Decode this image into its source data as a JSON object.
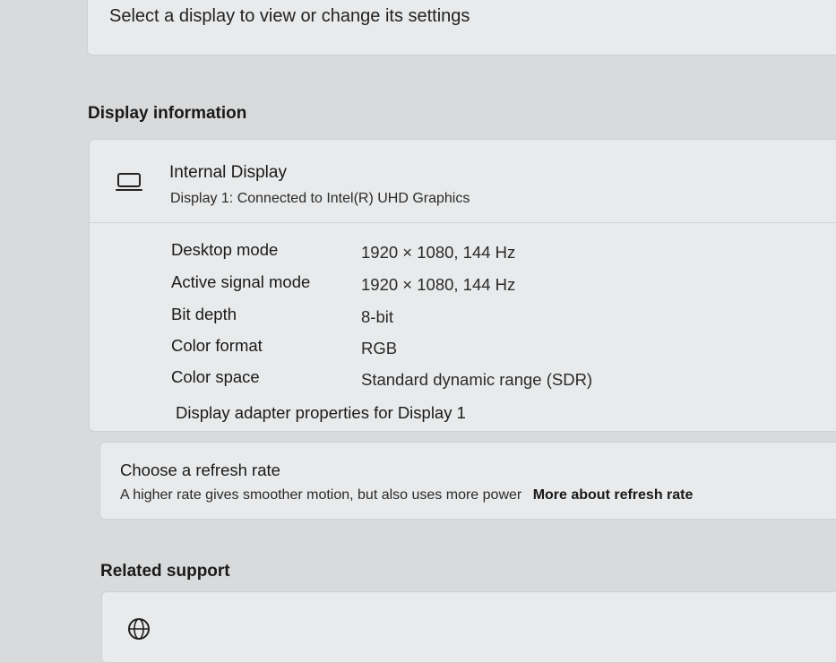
{
  "top": {
    "prompt": "Select a display to view or change its settings"
  },
  "display_info": {
    "heading": "Display information",
    "icon": "monitor-icon",
    "name": "Internal Display",
    "subtitle": "Display 1: Connected to Intel(R) UHD Graphics",
    "rows": [
      {
        "label": "Desktop mode",
        "value": "1920 × 1080, 144 Hz"
      },
      {
        "label": "Active signal mode",
        "value": "1920 × 1080, 144 Hz"
      },
      {
        "label": "Bit depth",
        "value": "8-bit"
      },
      {
        "label": "Color format",
        "value": "RGB"
      },
      {
        "label": "Color space",
        "value": "Standard dynamic range (SDR)"
      }
    ],
    "adapter_link": "Display adapter properties for Display 1"
  },
  "refresh": {
    "title": "Choose a refresh rate",
    "description": "A higher rate gives smoother motion, but also uses more power",
    "link": "More about refresh rate"
  },
  "related": {
    "heading": "Related support",
    "icon": "globe-icon"
  }
}
